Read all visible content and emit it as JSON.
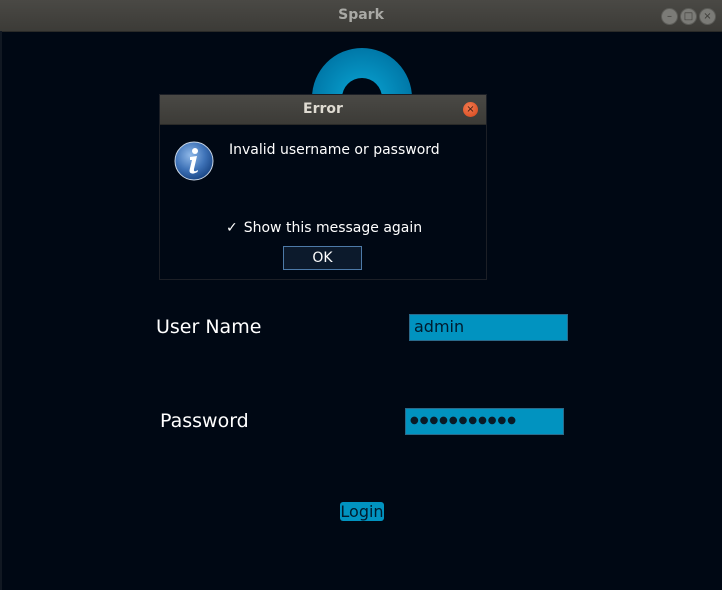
{
  "window": {
    "title": "Spark",
    "controls": {
      "minimize_icon": "minimize-icon",
      "maximize_icon": "maximize-icon",
      "close_icon": "close-icon"
    }
  },
  "dialog": {
    "title": "Error",
    "message": "Invalid username or password",
    "icon": "info-icon",
    "show_again_label": "Show this message again",
    "show_again_checked": true,
    "check_mark": "✓",
    "ok_label": "OK"
  },
  "form": {
    "username_label": "User Name",
    "username_value": "admin",
    "password_label": "Password",
    "password_mask": "●●●●●●●●●●●",
    "login_label": "Login"
  },
  "colors": {
    "background": "#000814",
    "field_bg": "#0193c0",
    "titlebar": "#3c3b37",
    "close_button": "#e05a2b"
  }
}
